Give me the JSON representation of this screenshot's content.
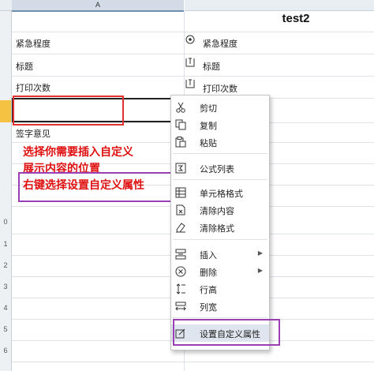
{
  "sheet": {
    "column_a_label": "A",
    "title": "test2",
    "rows": [
      {
        "left": "紧急程度",
        "right": "紧急程度",
        "right_icon": "radio-icon"
      },
      {
        "left": "标题",
        "right": "标题",
        "right_icon": "text-field-icon"
      },
      {
        "left": "打印次数",
        "right": "打印次数",
        "right_icon": "text-field-icon"
      }
    ],
    "sign_label": "签字意见",
    "row_numbers": [
      "0",
      "1",
      "2",
      "3",
      "4",
      "5",
      "6"
    ]
  },
  "annotations": {
    "line1": "选择你需要插入自定义",
    "line2": "展示内容的位置",
    "line3": "右键选择设置自定义属性",
    "red_color": "#e23131",
    "purple_color": "#9b3fb5"
  },
  "context_menu": {
    "items": [
      {
        "label": "剪切",
        "icon": "scissors-icon"
      },
      {
        "label": "复制",
        "icon": "copy-icon"
      },
      {
        "label": "粘贴",
        "icon": "paste-icon"
      },
      {
        "label": "公式列表",
        "icon": "formula-icon"
      },
      {
        "label": "单元格格式",
        "icon": "cell-format-icon"
      },
      {
        "label": "清除内容",
        "icon": "clear-content-icon"
      },
      {
        "label": "清除格式",
        "icon": "eraser-icon"
      },
      {
        "label": "插入",
        "icon": "insert-icon",
        "submenu": "▶"
      },
      {
        "label": "删除",
        "icon": "delete-icon",
        "submenu": "▶"
      },
      {
        "label": "行高",
        "icon": "row-height-icon"
      },
      {
        "label": "列宽",
        "icon": "column-width-icon"
      },
      {
        "label": "设置自定义属性",
        "icon": "custom-property-icon"
      }
    ]
  }
}
